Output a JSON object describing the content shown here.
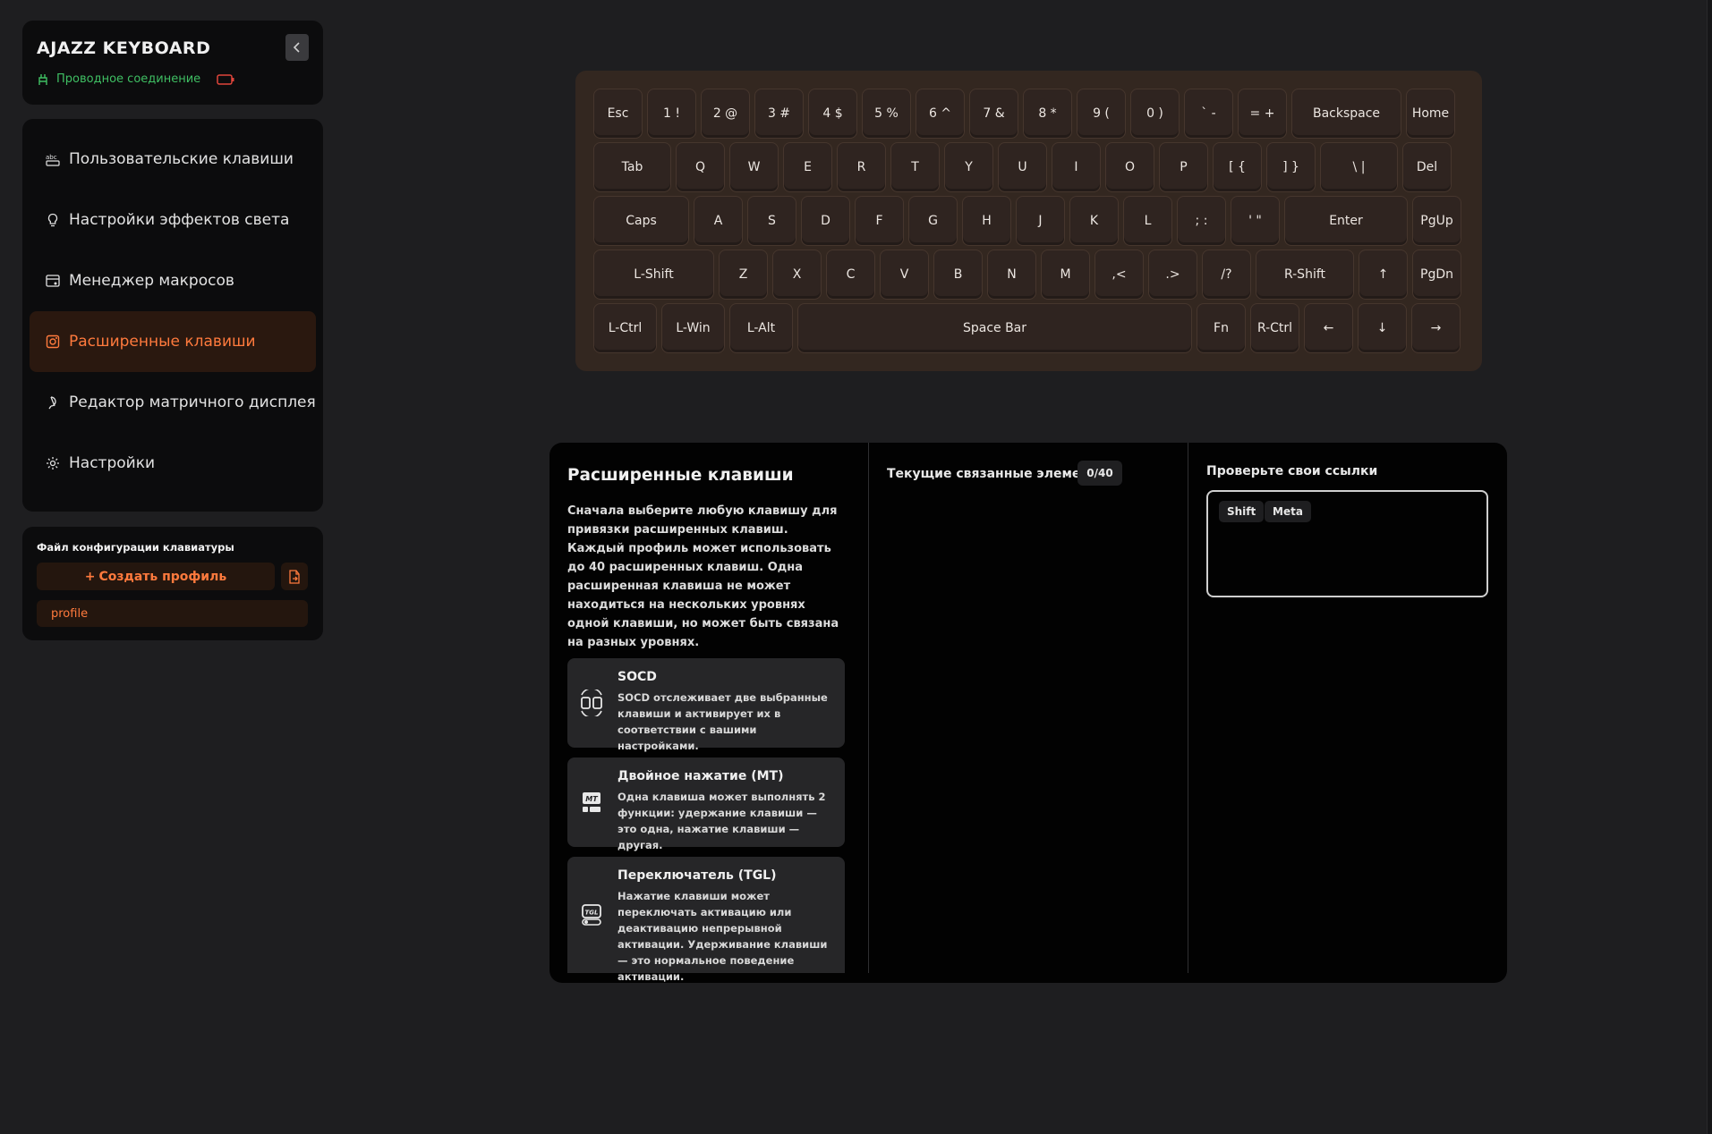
{
  "app": {
    "title": "AJAZZ KEYBOARD",
    "connection": "Проводное соединение"
  },
  "colors": {
    "accent": "#ff7a3d",
    "connection": "#3fbf63",
    "battery": "#e0453b"
  },
  "nav": {
    "items": [
      {
        "label": "Пользовательские клавиши",
        "icon": "keyboard-text-icon"
      },
      {
        "label": "Настройки эффектов света",
        "icon": "lightbulb-icon"
      },
      {
        "label": "Менеджер макросов",
        "icon": "macro-icon"
      },
      {
        "label": "Расширенные клавиши",
        "icon": "advanced-key-icon",
        "active": true
      },
      {
        "label": "Редактор матричного дисплея",
        "icon": "palette-icon"
      },
      {
        "label": "Настройки",
        "icon": "gear-icon"
      }
    ]
  },
  "profile": {
    "header": "Файл конфигурации клавиатуры",
    "create_label": "Создать профиль",
    "create_plus": "+",
    "items": [
      "profile"
    ]
  },
  "keyboard": {
    "rows": [
      [
        "Esc",
        "1 !",
        "2 @",
        "3 #",
        "4 $",
        "5 %",
        "6 ^",
        "7 &",
        "8 *",
        "9 (",
        "0 )",
        "` -",
        "= +",
        "Backspace",
        "Home"
      ],
      [
        "Tab",
        "Q",
        "W",
        "E",
        "R",
        "T",
        "Y",
        "U",
        "I",
        "O",
        "P",
        "[ {",
        "] }",
        "\\ |",
        "Del"
      ],
      [
        "Caps",
        "A",
        "S",
        "D",
        "F",
        "G",
        "H",
        "J",
        "K",
        "L",
        "; :",
        "' \"",
        "Enter",
        "PgUp"
      ],
      [
        "L-Shift",
        "Z",
        "X",
        "C",
        "V",
        "B",
        "N",
        "M",
        ",<",
        ".>",
        "/?",
        "R-Shift",
        "↑",
        "PgDn"
      ],
      [
        "L-Ctrl",
        "L-Win",
        "L-Alt",
        "Space Bar",
        "Fn",
        "R-Ctrl",
        "←",
        "↓",
        "→"
      ]
    ]
  },
  "advanced": {
    "title": "Расширенные клавиши",
    "description": "Сначала выберите любую клавишу для привязки расширенных клавиш. Каждый профиль может использовать до 40 расширенных клавиш. Одна расширенная клавиша не может находиться на нескольких уровнях одной клавиши, но может быть связана на разных уровнях.",
    "cards": [
      {
        "title": "SOCD",
        "desc": "SOCD отслеживает две выбранные клавиши и активирует их в соответствии с вашими настройками."
      },
      {
        "title": "Двойное нажатие (MT)",
        "desc": "Одна клавиша может выполнять 2 функции: удержание клавиши — это одна, нажатие клавиши — другая."
      },
      {
        "title": "Переключатель (TGL)",
        "desc": "Нажатие клавиши может переключать активацию или деактивацию непрерывной активации. Удерживание клавиши — это нормальное поведение активации."
      }
    ],
    "current_label": "Текущие связанные элементы",
    "current_count": "0/40",
    "check_label": "Проверьте свои ссылки",
    "chips": [
      "Shift",
      "Meta"
    ]
  }
}
